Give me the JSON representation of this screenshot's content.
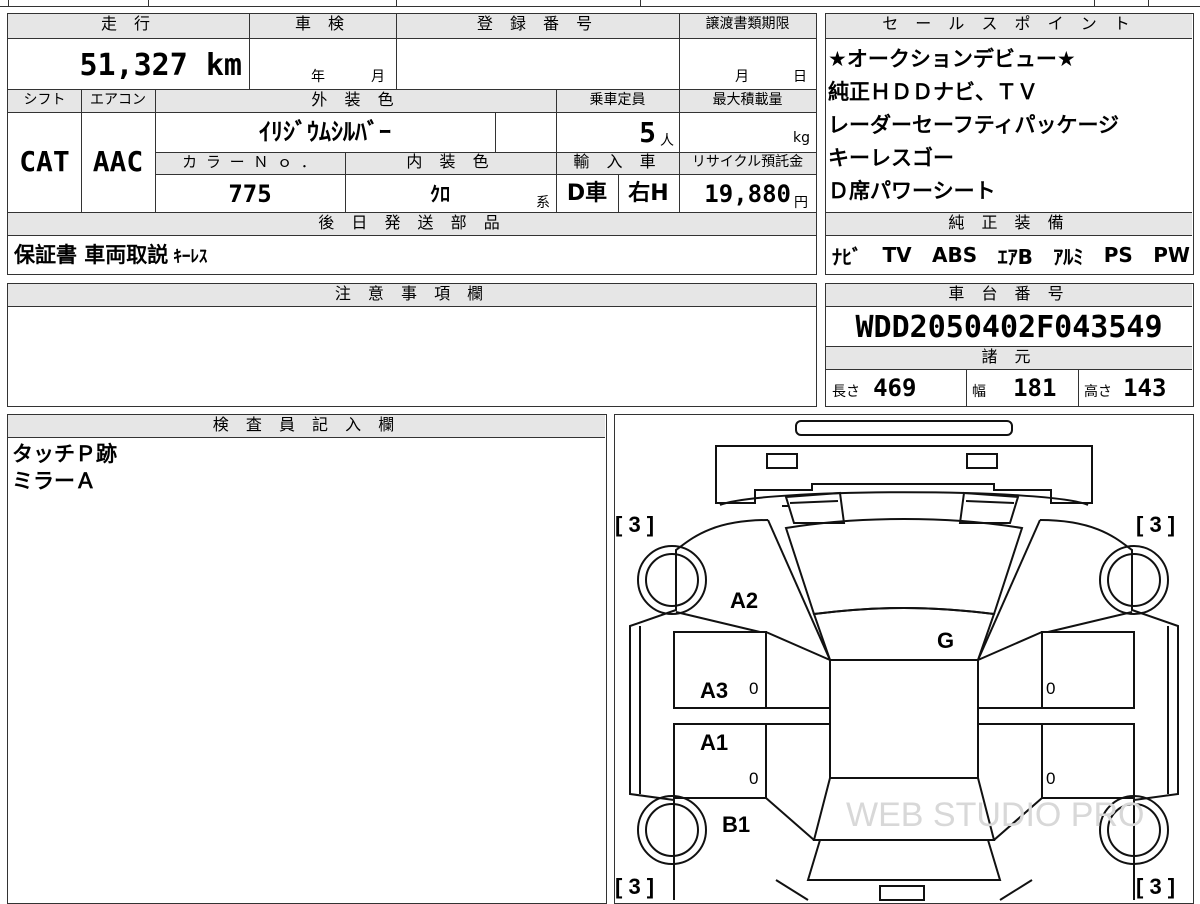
{
  "form": {
    "mileage": {
      "label": "走 行",
      "value": "51,327",
      "unit": "km"
    },
    "inspection": {
      "label": "車 検",
      "year_unit": "年",
      "month_unit": "月"
    },
    "registration": {
      "label": "登 録 番 号"
    },
    "transfer": {
      "label": "譲渡書類期限",
      "month_unit": "月",
      "day_unit": "日"
    },
    "shift": {
      "label": "シフト",
      "value": "CAT"
    },
    "aircon": {
      "label": "エアコン",
      "value": "AAC"
    },
    "exterior_color": {
      "label": "外 装 色",
      "value": "ｲﾘｼﾞｳﾑｼﾙﾊﾞｰ"
    },
    "capacity": {
      "label": "乗車定員",
      "value": "5",
      "unit": "人"
    },
    "max_load": {
      "label": "最大積載量",
      "unit": "kg"
    },
    "color_no": {
      "label": "カ ラ ー Ｎ ｏ ．",
      "value": "775"
    },
    "interior_color": {
      "label": "内 装 色",
      "value": "ｸﾛ",
      "suffix": "系"
    },
    "import": {
      "label": "輸 入 車",
      "type": "D車",
      "handle": "右H"
    },
    "recycle": {
      "label": "リサイクル預託金",
      "value": "19,880",
      "unit": "円"
    },
    "shipping_parts": {
      "label": "後 日 発 送 部 品",
      "value_main": "保証書 車両取説",
      "value_small": "ｷｰﾚｽ"
    },
    "notes": {
      "label": "注 意 事 項 欄"
    },
    "inspector": {
      "label": "検 査 員 記 入 欄",
      "lines": [
        "タッチＰ跡",
        "ミラーＡ"
      ]
    }
  },
  "sales": {
    "label": "セ ー ル ス ポ イ ン ト",
    "points": [
      "★オークションデビュー★",
      "純正ＨＤＤナビ、ＴＶ",
      "レーダーセーフティパッケージ",
      "キーレスゴー",
      "Ｄ席パワーシート"
    ]
  },
  "equipment": {
    "label": "純 正 装 備",
    "items": [
      "ﾅﾋﾞ",
      "TV",
      "ABS",
      "ｴｱB",
      "ｱﾙﾐ",
      "PS",
      "PW"
    ]
  },
  "chassis": {
    "label": "車 台 番 号",
    "value": "WDD2050402F043549"
  },
  "specs": {
    "label": "諸 元",
    "length": {
      "label": "長さ",
      "value": "469"
    },
    "width": {
      "label": "幅",
      "value": "181"
    },
    "height": {
      "label": "高さ",
      "value": "143"
    }
  },
  "diagram": {
    "tire_label": "[ 3 ]",
    "marks": {
      "a2": "A2",
      "g": "G",
      "a3": "A3",
      "a1": "A1",
      "b1": "B1"
    },
    "door_value": "0",
    "watermark": "WEB STUDIO PRO"
  }
}
